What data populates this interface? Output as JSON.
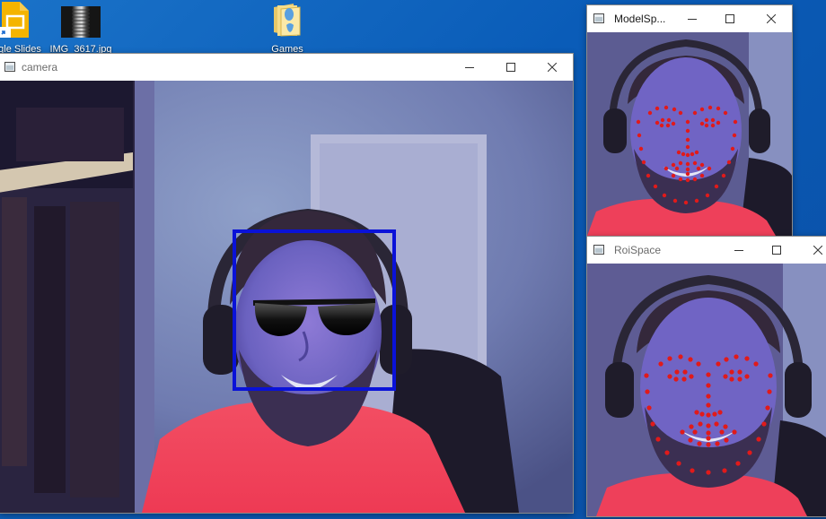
{
  "desktop": {
    "icons": [
      {
        "label": "gle Slides",
        "icon": "google-slides-icon"
      },
      {
        "label": "IMG_3617.jpg",
        "icon": "image-file-icon"
      },
      {
        "label": "Games",
        "icon": "folder-icon"
      }
    ]
  },
  "windows": {
    "camera": {
      "title": "camera"
    },
    "model": {
      "title": "ModelSp..."
    },
    "roi": {
      "title": "RoiSpace"
    }
  },
  "colors": {
    "desktop": "#0a5cb8",
    "face_box": "#0a12d8",
    "landmarks": "#e11a1a",
    "shirt": "#f0455d"
  }
}
